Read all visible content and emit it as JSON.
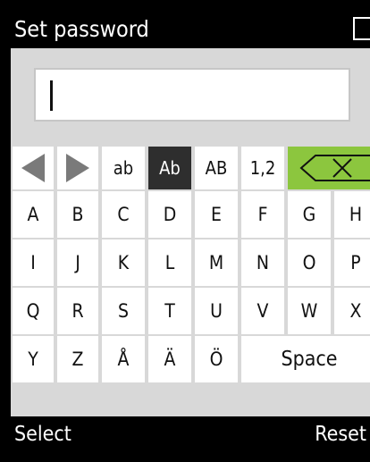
{
  "title_bar": {
    "title": "Set password"
  },
  "password_field": {
    "value": ""
  },
  "keyboard": {
    "mode_keys": [
      "ab",
      "Ab",
      "AB",
      "1,2"
    ],
    "active_mode": "Ab",
    "rows": [
      [
        "A",
        "B",
        "C",
        "D",
        "E",
        "F",
        "G",
        "H"
      ],
      [
        "I",
        "J",
        "K",
        "L",
        "M",
        "N",
        "O",
        "P"
      ],
      [
        "Q",
        "R",
        "S",
        "T",
        "U",
        "V",
        "W",
        "X"
      ],
      [
        "Y",
        "Z",
        "Å",
        "Ä",
        "Ö"
      ]
    ],
    "space_label": "Space"
  },
  "soft_keys": {
    "left": "Select",
    "right": "Reset"
  },
  "colors": {
    "background": "#d8d8d8",
    "bars": "#000000",
    "active_key": "#2e2e2e",
    "backspace_key": "#8cc63e",
    "arrow": "#7a7a7a"
  }
}
